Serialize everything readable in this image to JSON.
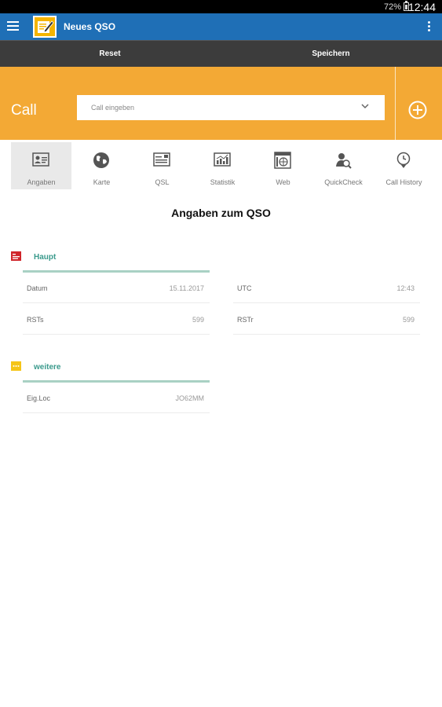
{
  "status": {
    "battery": "72%",
    "time": "12:44"
  },
  "appbar": {
    "title": "Neues QSO",
    "menu_icon": "hamburger-menu-icon",
    "logo_icon": "edit-notepad-icon",
    "overflow_icon": "more-vert-icon"
  },
  "actions": {
    "reset": "Reset",
    "save": "Speichern"
  },
  "call": {
    "label": "Call",
    "placeholder": "Call eingeben",
    "add_icon": "add-circle-icon"
  },
  "tabs": [
    {
      "label": "Angaben",
      "icon": "contact-card-icon",
      "active": true
    },
    {
      "label": "Karte",
      "icon": "globe-icon",
      "active": false
    },
    {
      "label": "QSL",
      "icon": "qsl-card-icon",
      "active": false
    },
    {
      "label": "Statistik",
      "icon": "statistics-chart-icon",
      "active": false
    },
    {
      "label": "Web",
      "icon": "web-browser-icon",
      "active": false
    },
    {
      "label": "QuickCheck",
      "icon": "quickcheck-search-user-icon",
      "active": false
    },
    {
      "label": "Call History",
      "icon": "call-history-icon",
      "active": false
    }
  ],
  "heading": "Angaben zum QSO",
  "sections": {
    "haupt": {
      "title": "Haupt",
      "rows": [
        {
          "key": "Datum",
          "value": "15.11.2017"
        },
        {
          "key": "UTC",
          "value": "12:43"
        },
        {
          "key": "RSTs",
          "value": "599"
        },
        {
          "key": "RSTr",
          "value": "599"
        }
      ]
    },
    "weitere": {
      "title": "weitere",
      "rows": [
        {
          "key": "Eig.Loc",
          "value": "JO62MM"
        }
      ]
    }
  },
  "colors": {
    "appbar": "#1f6fb6",
    "actionbar": "#3c3c3c",
    "callpanel": "#f3a935",
    "section_title": "#3a9a8c",
    "haupt_icon": "#d0252b",
    "weitere_icon": "#f5c518"
  }
}
